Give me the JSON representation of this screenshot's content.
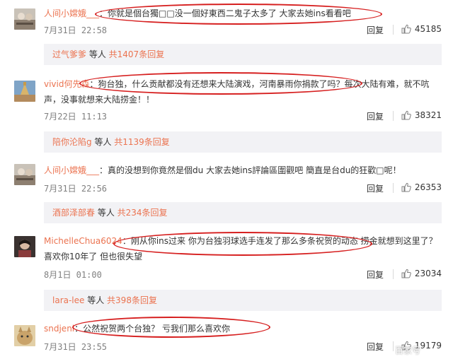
{
  "comments": [
    {
      "user": "人间小嫦娥___",
      "sep": "：",
      "text": "你就是個台獨□□没一個好東西二鬼子太多了 大家去她ins看看吧",
      "time": "7月31日 22:58",
      "reply": "回复",
      "likes": "45185",
      "replies": {
        "user": "过气爹爹",
        "mid": " 等人 ",
        "count": "共1407条回复"
      }
    },
    {
      "user": "vivid何先森",
      "sep": "：",
      "text": "狗台独，什么贡献都没有还想来大陆演戏，河南暴雨你捐款了吗？每次大陆有难，就不吭声，没事就想来大陆捞金！！",
      "time": "7月22日 11:13",
      "reply": "回复",
      "likes": "38321",
      "replies": {
        "user": "陪你沦陷g",
        "mid": " 等人 ",
        "count": "共1139条回复"
      }
    },
    {
      "user": "人间小嫦娥___",
      "sep": "：",
      "text": "真的没想到你竟然是個du 大家去她ins評論區圍觀吧 簡直是台du的狂歡□呢！",
      "time": "7月31日 22:56",
      "reply": "回复",
      "likes": "26353",
      "replies": {
        "user": "酒部泽部春",
        "mid": " 等人 ",
        "count": "共234条回复"
      }
    },
    {
      "user": "MichelleChua6024",
      "sep": "：",
      "text": "刚从你ins过来 你为台独羽球选手连发了那么多条祝贺的动态 捞金就想到这里了？喜欢你10年了 但也很失望",
      "time": "8月1日 01:00",
      "reply": "回复",
      "likes": "23034",
      "replies": {
        "user": "lara-lee",
        "mid": " 等人 ",
        "count": "共398条回复"
      }
    },
    {
      "user": "sndjenl",
      "sep": "：",
      "text": "公然祝贺两个台独？ 亏我们那么喜欢你",
      "time": "7月31日 23:55",
      "reply": "回复",
      "likes": "19179"
    }
  ],
  "icons": {
    "like": "thumbs-up-icon",
    "avatar": "user-avatar"
  },
  "colors": {
    "username": "#eb7350",
    "highlight": "#d61f1f",
    "replybar": "#f2f2f5"
  },
  "watermark": "百家号"
}
